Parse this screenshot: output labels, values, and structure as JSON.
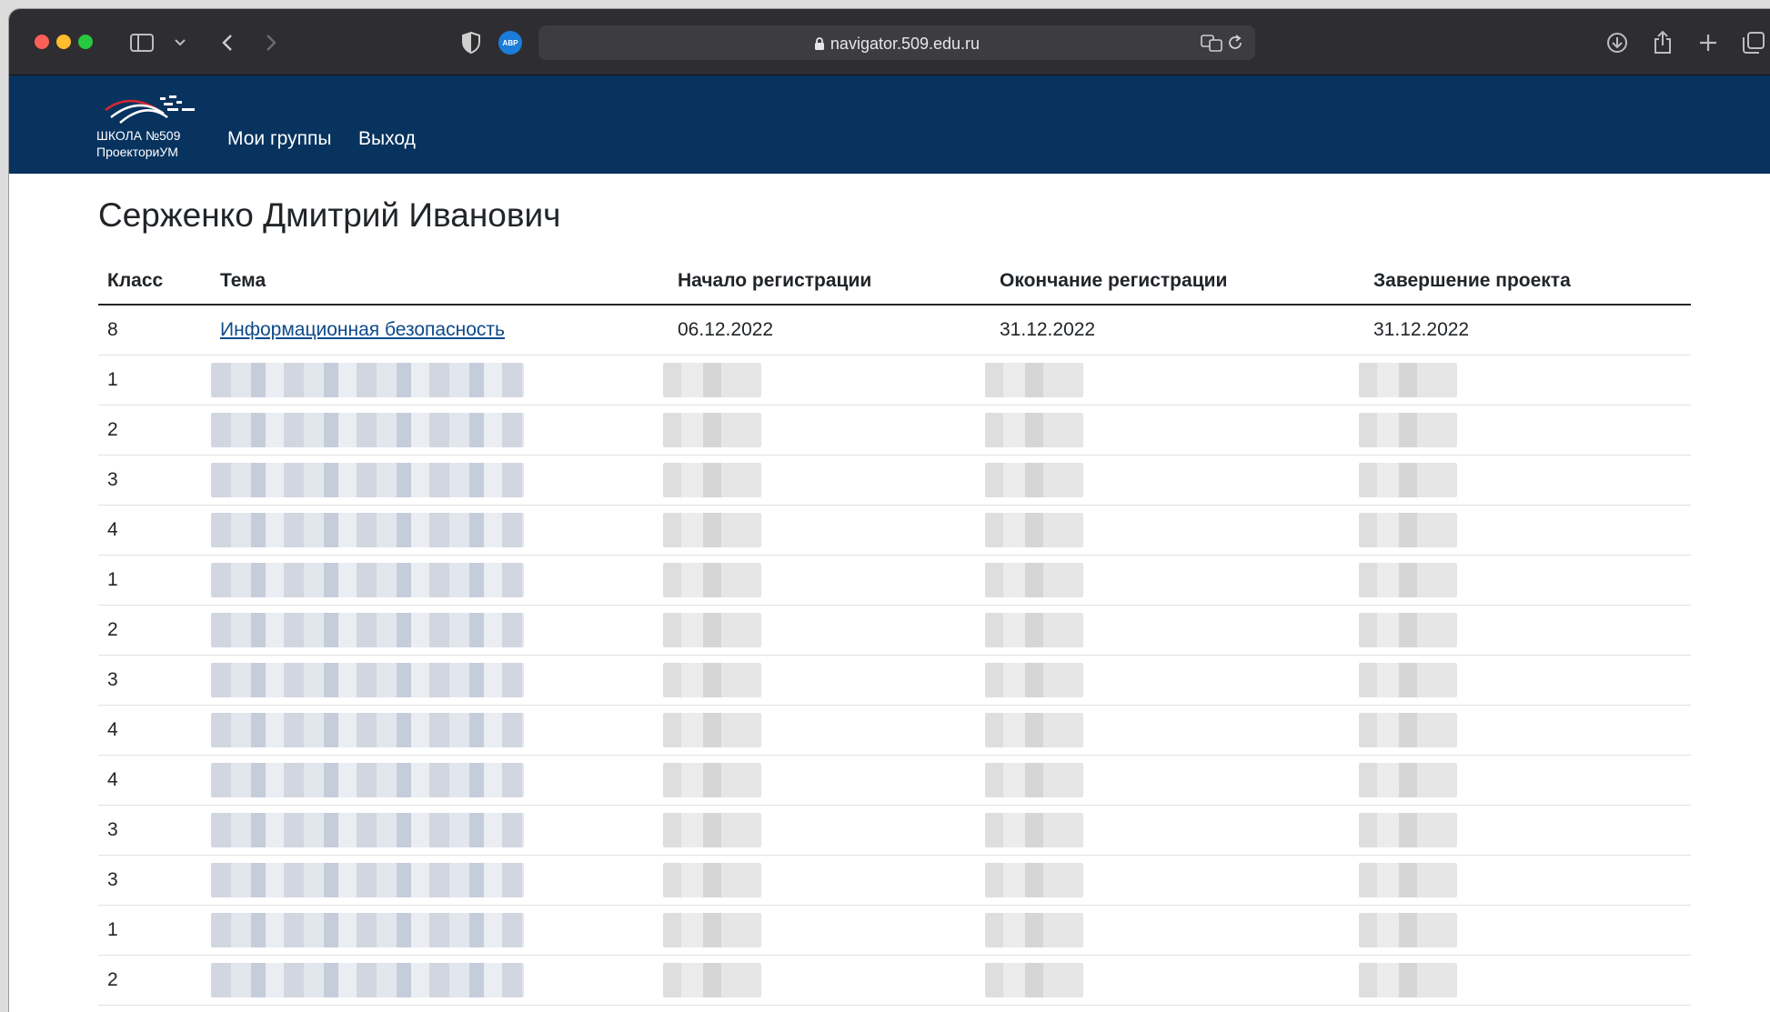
{
  "browser": {
    "url": "navigator.509.edu.ru",
    "adblock_label": "ABP"
  },
  "site": {
    "logo_line1": "ШКОЛА №509",
    "logo_line2": "ПроекториУМ",
    "nav": [
      "Мои группы",
      "Выход"
    ]
  },
  "page": {
    "title": "Серженко Дмитрий Иванович",
    "columns": [
      "Класс",
      "Тема",
      "Начало регистрации",
      "Окончание регистрации",
      "Завершение проекта"
    ],
    "first_row": {
      "class": "8",
      "topic": "Информационная безопасность",
      "start": "06.12.2022",
      "end": "31.12.2022",
      "finish": "31.12.2022"
    },
    "blurred_row_classes": [
      "1",
      "2",
      "3",
      "4",
      "1",
      "2",
      "3",
      "4",
      "4",
      "3",
      "3",
      "1",
      "2"
    ]
  },
  "colors": {
    "header_bg": "#08335f",
    "link": "#0d4a8a"
  }
}
